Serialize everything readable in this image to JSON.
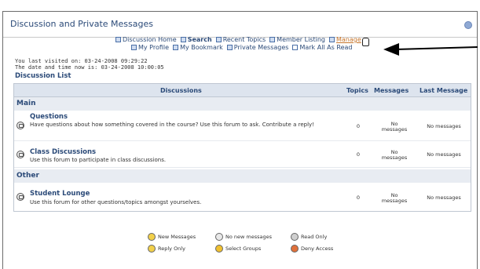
{
  "header": {
    "title": "Discussion and Private Messages"
  },
  "nav": {
    "row1": [
      {
        "label": "Discussion Home",
        "icon": "home-icon"
      },
      {
        "label": "Search",
        "icon": "search-icon",
        "bold": true
      },
      {
        "label": "Recent Topics",
        "icon": "recent-topics-icon"
      },
      {
        "label": "Member Listing",
        "icon": "member-listing-icon"
      },
      {
        "label": "Manage",
        "icon": "manage-icon",
        "highlight": true
      }
    ],
    "row2": [
      {
        "label": "My Profile",
        "icon": "profile-icon"
      },
      {
        "label": "My Bookmark",
        "icon": "bookmark-icon"
      },
      {
        "label": "Private Messages",
        "icon": "private-messages-icon"
      },
      {
        "label": "Mark All As Read",
        "icon": "checkbox-icon"
      }
    ]
  },
  "visit": {
    "last_visited": "You last visited on: 03-24-2008 09:29:22",
    "now": "The date and time now is: 03-24-2008 10:00:05"
  },
  "list_title": "Discussion List",
  "table": {
    "headers": {
      "discussions": "Discussions",
      "topics": "Topics",
      "messages": "Messages",
      "last_message": "Last Message"
    },
    "categories": [
      {
        "name": "Main"
      },
      {
        "name": "Other"
      }
    ],
    "forums": [
      {
        "name": "Questions",
        "description": "Have questions about how something covered in the course? Use this forum to ask. Contribute a reply!",
        "topics": "0",
        "messages": "No messages",
        "last_message": "No messages"
      },
      {
        "name": "Class Discussions",
        "description": "Use this forum to participate in class discussions.",
        "topics": "0",
        "messages": "No messages",
        "last_message": "No messages"
      },
      {
        "name": "Student Lounge",
        "description": "Use this forum for other questions/topics amongst yourselves.",
        "topics": "0",
        "messages": "No messages",
        "last_message": "No messages"
      }
    ]
  },
  "legend": {
    "items": [
      {
        "label": "New Messages",
        "color": "#f2d04a"
      },
      {
        "label": "No new messages",
        "color": "#e8e8e8"
      },
      {
        "label": "Read Only",
        "color": "#cfcfcf"
      },
      {
        "label": "Reply Only",
        "color": "#f2d04a"
      },
      {
        "label": "Select Groups",
        "color": "#f0c030"
      },
      {
        "label": "Deny Access",
        "color": "#e0703a"
      }
    ]
  },
  "colors": {
    "link": "#2b4a78",
    "manage": "#c7762c",
    "header_bg": "#dde4ee"
  }
}
